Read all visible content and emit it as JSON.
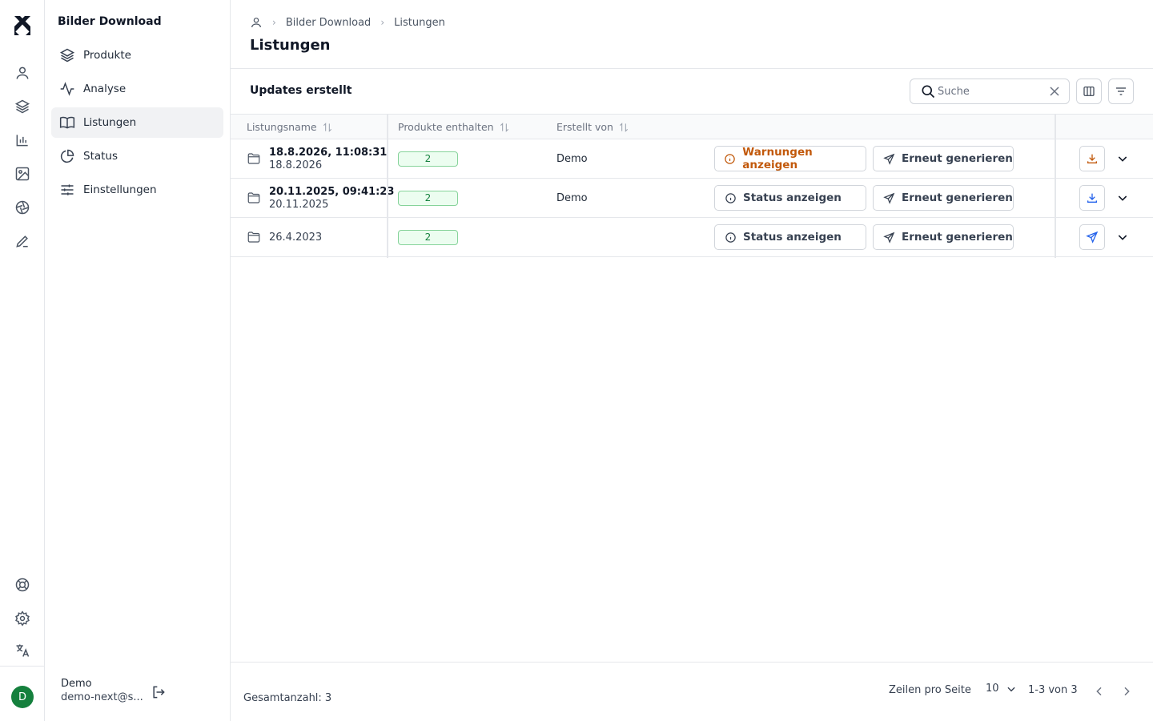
{
  "app": {
    "section_title": "Bilder Download",
    "user": {
      "initial": "D",
      "name": "Demo",
      "email": "demo-next@s..."
    }
  },
  "rail": {
    "top_icons": [
      "user-icon",
      "layers-icon",
      "bar-chart-icon",
      "image-icon",
      "aperture-icon",
      "pen-icon"
    ],
    "bottom_icons": [
      "lifebuoy-icon",
      "gear-icon",
      "translate-icon"
    ]
  },
  "sidebar": {
    "items": [
      {
        "label": "Produkte",
        "icon": "layers-icon",
        "active": false
      },
      {
        "label": "Analyse",
        "icon": "activity-icon",
        "active": false
      },
      {
        "label": "Listungen",
        "icon": "book-icon",
        "active": true
      },
      {
        "label": "Status",
        "icon": "pie-chart-icon",
        "active": false
      },
      {
        "label": "Einstellungen",
        "icon": "sliders-icon",
        "active": false
      }
    ]
  },
  "breadcrumb": {
    "items": [
      "Bilder Download",
      "Listungen"
    ]
  },
  "page": {
    "title": "Listungen",
    "subtitle": "Updates erstellt"
  },
  "search": {
    "placeholder": "Suche",
    "value": ""
  },
  "table": {
    "headers": {
      "name": "Listungsname",
      "products": "Produkte enthalten",
      "creator": "Erstellt von"
    },
    "rows": [
      {
        "title": "18.8.2026, 11:08:31",
        "date": "18.8.2026",
        "products": "2",
        "creator": "Demo",
        "status_action": "Warnungen anzeigen",
        "status_type": "warning",
        "regen_action": "Erneut generieren",
        "side_action": "download-icon"
      },
      {
        "title": "20.11.2025, 09:41:23",
        "date": "20.11.2025",
        "products": "2",
        "creator": "Demo",
        "status_action": "Status anzeigen",
        "status_type": "info",
        "regen_action": "Erneut generieren",
        "side_action": "download-icon"
      },
      {
        "title": "",
        "date": "26.4.2023",
        "products": "2",
        "creator": "",
        "status_action": "Status anzeigen",
        "status_type": "info",
        "regen_action": "Erneut generieren",
        "side_action": "send-icon"
      }
    ]
  },
  "footer": {
    "total": "Gesamtanzahl: 3",
    "rows_per_page_label": "Zeilen pro Seite",
    "rows_per_page": "10",
    "range": "1-3 von 3"
  },
  "colors": {
    "warning": "#c2590b",
    "success_badge": "#15803d",
    "download": "#c2590b",
    "send": "#2563eb",
    "avatar": "#15803d"
  }
}
